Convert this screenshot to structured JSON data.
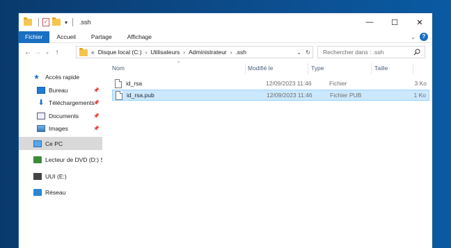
{
  "window": {
    "title": ".ssh",
    "controls": {
      "minimize": "—",
      "maximize": "☐",
      "close": "✕"
    }
  },
  "ribbon": {
    "tabs": [
      "Fichier",
      "Accueil",
      "Partage",
      "Affichage"
    ],
    "active_tab": "Fichier"
  },
  "address": {
    "prefix": "«",
    "crumbs": [
      "Disque local (C:)",
      "Utilisateurs",
      "Administrateur",
      ".ssh"
    ]
  },
  "search": {
    "placeholder": "Rechercher dans : .ssh"
  },
  "navpane": {
    "items": [
      {
        "label": "Accès rapide",
        "icon": "star-icon"
      },
      {
        "label": "Bureau",
        "icon": "desktop-icon",
        "pinned": true
      },
      {
        "label": "Téléchargements",
        "icon": "download-icon",
        "pinned": true
      },
      {
        "label": "Documents",
        "icon": "documents-icon",
        "pinned": true
      },
      {
        "label": "Images",
        "icon": "images-icon",
        "pinned": true
      },
      {
        "label": "Ce PC",
        "icon": "computer-icon",
        "selected": true
      },
      {
        "label": "Lecteur de DVD (D:) S",
        "icon": "dvd-drive-icon"
      },
      {
        "label": "UUI (E:)",
        "icon": "usb-drive-icon"
      },
      {
        "label": "Réseau",
        "icon": "network-icon"
      }
    ]
  },
  "columns": {
    "name": "Nom",
    "modified": "Modifié le",
    "type": "Type",
    "size": "Taille"
  },
  "files": [
    {
      "name": "id_rsa",
      "modified": "12/09/2023 11:46",
      "type": "Fichier",
      "size": "3 Ko",
      "selected": false
    },
    {
      "name": "id_rsa.pub",
      "modified": "12/09/2023 11:46",
      "type": "Fichier PUB",
      "size": "1 Ko",
      "selected": true
    }
  ],
  "colors": {
    "accent": "#1a6fc1",
    "selection": "#cce8ff",
    "folder": "#f4c64f"
  }
}
